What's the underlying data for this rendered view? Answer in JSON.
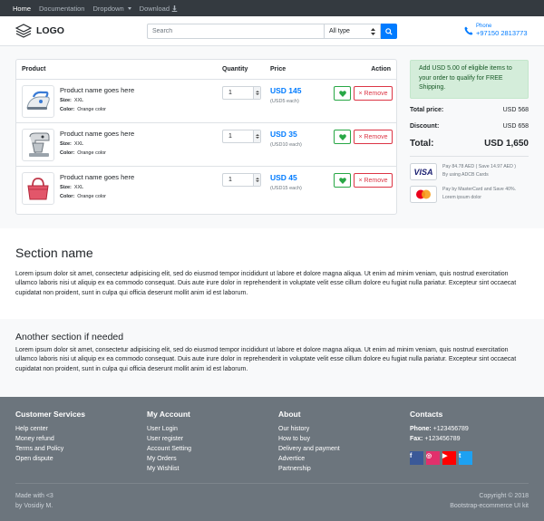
{
  "topnav": {
    "items": [
      "Home",
      "Documentation",
      "Dropdown",
      "Download"
    ]
  },
  "header": {
    "logo_text": "LOGO",
    "search_placeholder": "Search",
    "type_select": "All type",
    "phone_label": "Phone",
    "phone_number": "+97150 2813773"
  },
  "cart": {
    "columns": [
      "Product",
      "Quantity",
      "Price",
      "Action"
    ],
    "size_label": "Size:",
    "color_label": "Color:",
    "remove_label": "× Remove",
    "items": [
      {
        "name": "Product name goes here",
        "size": "XXL",
        "color": "Orange color",
        "qty": "1",
        "price": "USD 145",
        "each": "(USD5 each)",
        "image": "iron-icon"
      },
      {
        "name": "Product name goes here",
        "size": "XXL",
        "color": "Orange color",
        "qty": "1",
        "price": "USD 35",
        "each": "(USD10 each)",
        "image": "mixer-icon"
      },
      {
        "name": "Product name goes here",
        "size": "XXL",
        "color": "Orange color",
        "qty": "1",
        "price": "USD 45",
        "each": "(USD15 each)",
        "image": "handbag-icon"
      }
    ]
  },
  "summary": {
    "promo": "Add USD 5.00 of eligible items to your order to qualify for FREE Shipping.",
    "total_price_label": "Total price:",
    "total_price": "USD 568",
    "discount_label": "Discount:",
    "discount": "USD 658",
    "total_label": "Total:",
    "total": "USD 1,650",
    "visa_text_1": "Pay 84.78 AED ( Save 14.97 AED )",
    "visa_text_2": "By using ADCB Cards",
    "visa_label": "VISA",
    "mc_text_1": "Pay by MasterCard and Save 40%.",
    "mc_text_2": "Lorem ipsum dolor"
  },
  "section1": {
    "title": "Section name",
    "body": "Lorem ipsum dolor sit amet, consectetur adipisicing elit, sed do eiusmod tempor incididunt ut labore et dolore magna aliqua. Ut enim ad minim veniam, quis nostrud exercitation ullamco laboris nisi ut aliquip ex ea commodo consequat. Duis aute irure dolor in reprehenderit in voluptate velit esse cillum dolore eu fugiat nulla pariatur. Excepteur sint occaecat cupidatat non proident, sunt in culpa qui officia deserunt mollit anim id est laborum."
  },
  "section2": {
    "title": "Another section if needed",
    "body": "Lorem ipsum dolor sit amet, consectetur adipisicing elit, sed do eiusmod tempor incididunt ut labore et dolore magna aliqua. Ut enim ad minim veniam, quis nostrud exercitation ullamco laboris nisi ut aliquip ex ea commodo consequat. Duis aute irure dolor in reprehenderit in voluptate velit esse cillum dolore eu fugiat nulla pariatur. Excepteur sint occaecat cupidatat non proident, sunt in culpa qui officia deserunt mollit anim id est laborum."
  },
  "footer": {
    "customer_services": {
      "title": "Customer Services",
      "links": [
        "Help center",
        "Money refund",
        "Terms and Policy",
        "Open dispute"
      ]
    },
    "my_account": {
      "title": "My Account",
      "links": [
        "User Login",
        "User register",
        "Account Setting",
        "My Orders",
        "My Wishlist"
      ]
    },
    "about": {
      "title": "About",
      "links": [
        "Our history",
        "How to buy",
        "Delivery and payment",
        "Advertice",
        "Partnership"
      ]
    },
    "contacts": {
      "title": "Contacts",
      "phone_label": "Phone:",
      "phone": "+123456789",
      "fax_label": "Fax:",
      "fax": "+123456789"
    },
    "social": [
      {
        "icon": "facebook-icon",
        "glyph": "f",
        "color": "#3b5998"
      },
      {
        "icon": "instagram-icon",
        "glyph": "◎",
        "color": "#e1306c"
      },
      {
        "icon": "youtube-icon",
        "glyph": "▶",
        "color": "#ff0000"
      },
      {
        "icon": "twitter-icon",
        "glyph": "t",
        "color": "#1da1f2"
      }
    ],
    "made_with_1": "Made with <3",
    "made_with_2": "by Vosidiy M.",
    "copyright_1": "Copyright © 2018",
    "copyright_2": "Bootstrap-ecommerce UI kit"
  },
  "colors": {
    "accent": "#007bff",
    "dark_nav": "#343a40",
    "footer": "#6c757d",
    "success_bg": "#d4edda",
    "danger": "#dc3545",
    "success": "#28a745"
  }
}
